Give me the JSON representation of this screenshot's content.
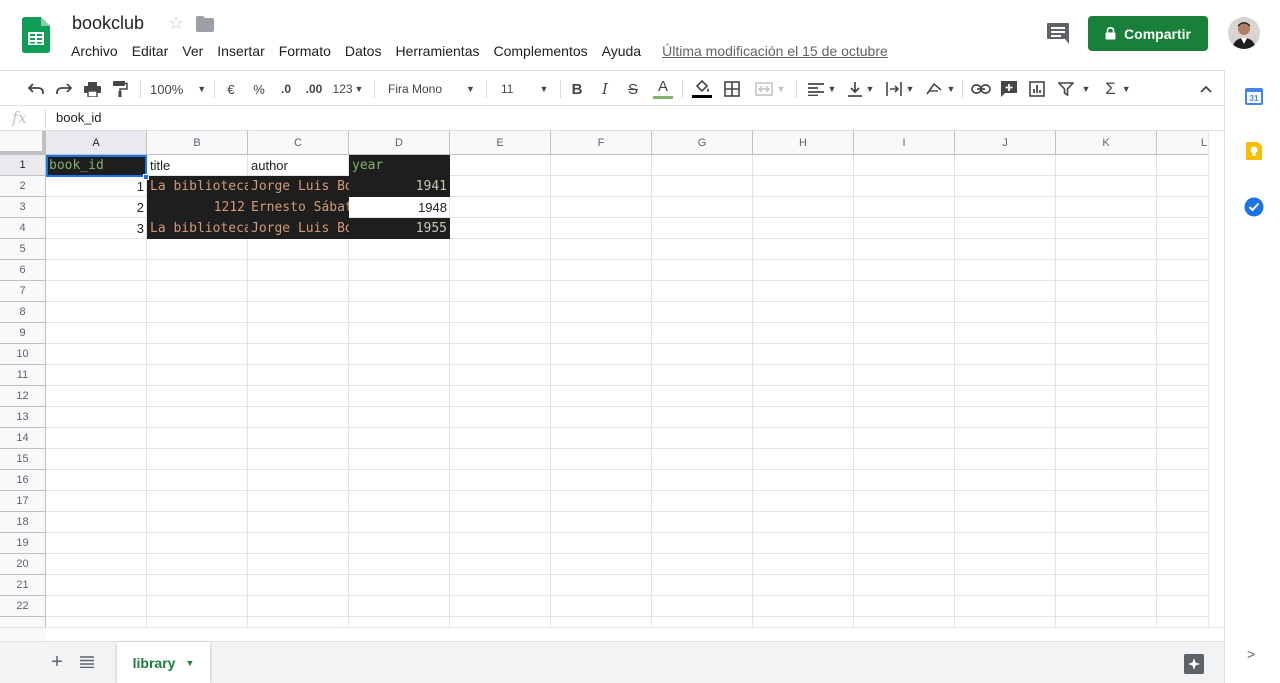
{
  "doc": {
    "title": "bookclub",
    "last_edit": "Última modificación el 15 de octubre",
    "share_label": "Compartir"
  },
  "menu": [
    "Archivo",
    "Editar",
    "Ver",
    "Insertar",
    "Formato",
    "Datos",
    "Herramientas",
    "Complementos",
    "Ayuda"
  ],
  "toolbar": {
    "zoom": "100%",
    "currency": "€",
    "percent": "%",
    "dec_decrease": ".0",
    "dec_increase": ".00",
    "number_format": "123",
    "font": "Fira Mono",
    "font_size": "11",
    "bold": "B",
    "italic": "I",
    "strike": "S",
    "text_color_glyph": "A",
    "sum_glyph": "Σ"
  },
  "formula_bar": {
    "fx_label": "fx",
    "value": "book_id"
  },
  "columns": [
    "A",
    "B",
    "C",
    "D",
    "E",
    "F",
    "G",
    "H",
    "I",
    "J",
    "K",
    "L"
  ],
  "rows": [
    "1",
    "2",
    "3",
    "4",
    "5",
    "6",
    "7",
    "8",
    "9",
    "10",
    "11",
    "12",
    "13",
    "14",
    "15",
    "16",
    "17",
    "18",
    "19",
    "20",
    "21",
    "22"
  ],
  "cells": {
    "A1": "book_id",
    "B1": "title",
    "C1": "author",
    "D1": "year",
    "A2": "1",
    "B2": "La biblioteca",
    "C2": "Jorge Luis Borges",
    "D2": "1941",
    "A3": "2",
    "B3": "1212",
    "C3": "Ernesto Sábato",
    "D3": "1948",
    "A4": "3",
    "B4": "La biblioteca",
    "C4": "Jorge Luis Borges",
    "D4": "1955"
  },
  "colors": {
    "share_green": "#188038",
    "selection_blue": "#1a73e8",
    "dark_cell_bg": "#1e1e1e",
    "mono_orange": "#d49a75",
    "mono_green": "#7fb36f",
    "mono_number": "#c8c8b0"
  },
  "sheets": [
    {
      "name": "library",
      "active": true
    }
  ],
  "side_panel": [
    "calendar-icon",
    "keep-icon",
    "tasks-icon"
  ]
}
